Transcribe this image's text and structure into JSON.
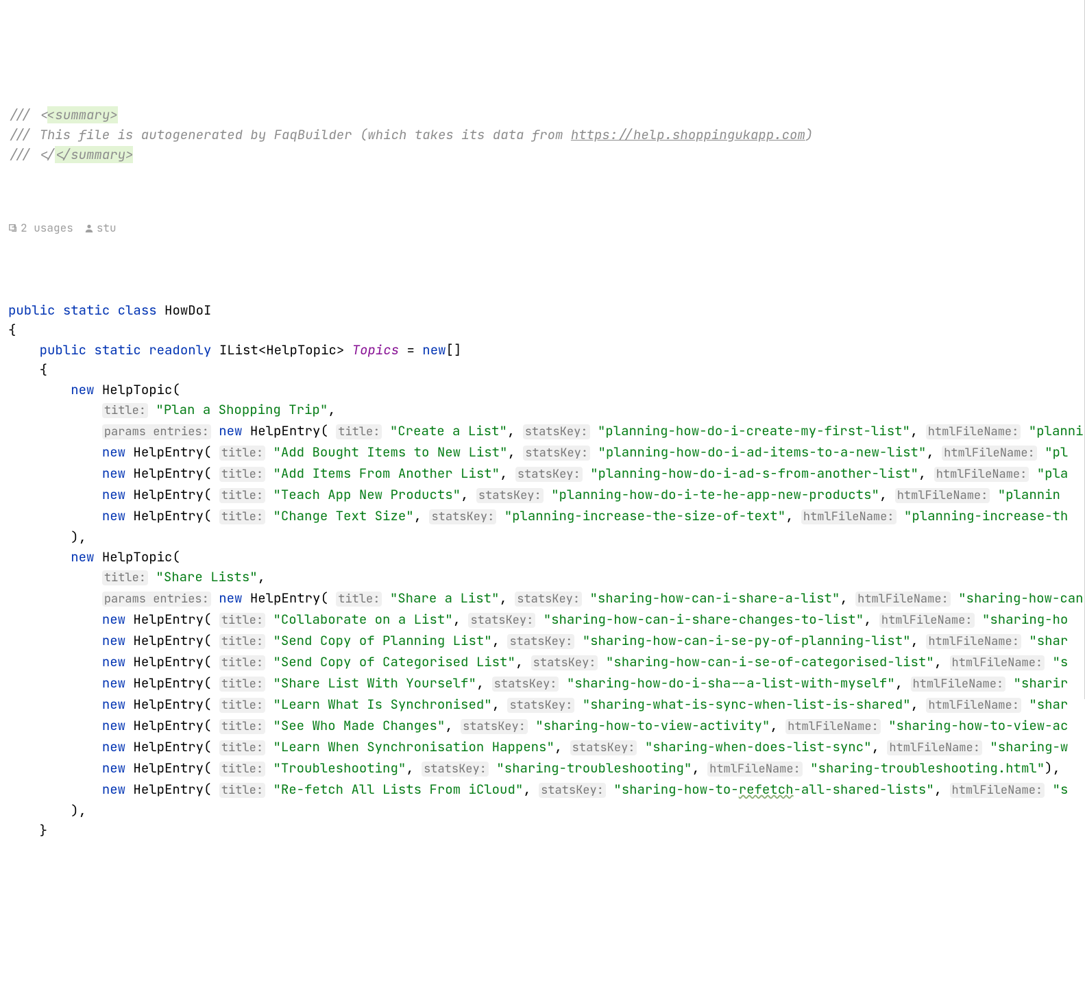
{
  "comments": {
    "summaryOpen": "<summary>",
    "summaryClose": "</summary>",
    "prefix": "/// ",
    "bodyPrefix": "This file is autogenerated by FaqBuilder (which takes its data from ",
    "link": "https://help.shoppingukapp.com",
    "bodySuffix": ")"
  },
  "codeLens": {
    "usages": "2 usages",
    "author": "stu"
  },
  "keywords": {
    "public": "public",
    "static": "static",
    "class": "class",
    "readonly": "readonly",
    "new": "new"
  },
  "classDecl": {
    "name": "HowDoI"
  },
  "field": {
    "type": "IList",
    "generic": "HelpTopic",
    "name": "Topics",
    "equals": " = ",
    "arrSuffix": "[]"
  },
  "hints": {
    "title": "title:",
    "paramsEntries": "params entries:",
    "statsKey": "statsKey:",
    "htmlFileName": "htmlFileName:"
  },
  "types": {
    "helpTopic": "HelpTopic",
    "helpEntry": "HelpEntry"
  },
  "topics": [
    {
      "title": "\"Plan a Shopping Trip\"",
      "entries": [
        {
          "title": "\"Create a List\"",
          "statsKey": "\"planning-how-do-i-create-my-first-list\"",
          "htmlFileName": "\"plannin",
          "paramsPrefix": true
        },
        {
          "title": "\"Add Bought Items to New List\"",
          "statsKey": "\"planning-how-do-i-ad-items-to-a-new-list\"",
          "htmlFileName": "\"pl"
        },
        {
          "title": "\"Add Items From Another List\"",
          "statsKey": "\"planning-how-do-i-ad-s-from-another-list\"",
          "htmlFileName": "\"pla"
        },
        {
          "title": "\"Teach App New Products\"",
          "statsKey": "\"planning-how-do-i-te-he-app-new-products\"",
          "htmlFileName": "\"plannin"
        },
        {
          "title": "\"Change Text Size\"",
          "statsKey": "\"planning-increase-the-size-of-text\"",
          "htmlFileName": "\"planning-increase-th"
        }
      ]
    },
    {
      "title": "\"Share Lists\"",
      "entries": [
        {
          "title": "\"Share a List\"",
          "statsKey": "\"sharing-how-can-i-share-a-list\"",
          "htmlFileName": "\"sharing-how-can-",
          "paramsPrefix": true
        },
        {
          "title": "\"Collaborate on a List\"",
          "statsKey": "\"sharing-how-can-i-share-changes-to-list\"",
          "htmlFileName": "\"sharing-ho"
        },
        {
          "title": "\"Send Copy of Planning List\"",
          "statsKey": "\"sharing-how-can-i-se-py-of-planning-list\"",
          "htmlFileName": "\"shar"
        },
        {
          "title": "\"Send Copy of Categorised List\"",
          "statsKey": "\"sharing-how-can-i-se-of-categorised-list\"",
          "htmlFileName": "\"s"
        },
        {
          "title": "\"Share List With Yourself\"",
          "statsKey": "\"sharing-how-do-i-sha--a-list-with-myself\"",
          "htmlFileName": "\"sharir"
        },
        {
          "title": "\"Learn What Is Synchronised\"",
          "statsKey": "\"sharing-what-is-sync-when-list-is-shared\"",
          "htmlFileName": "\"shar"
        },
        {
          "title": "\"See Who Made Changes\"",
          "statsKey": "\"sharing-how-to-view-activity\"",
          "htmlFileName": "\"sharing-how-to-view-ac"
        },
        {
          "title": "\"Learn When Synchronisation Happens\"",
          "statsKey": "\"sharing-when-does-list-sync\"",
          "htmlFileName": "\"sharing-w"
        },
        {
          "title": "\"Troubleshooting\"",
          "statsKey": "\"sharing-troubleshooting\"",
          "htmlFileName": "\"sharing-troubleshooting.html\"",
          "closed": true
        },
        {
          "title": "\"Re-fetch All Lists From iCloud\"",
          "statsKey": "\"sharing-how-to-refetch-all-shared-lists\"",
          "htmlFileName": "\"s",
          "wavy": "refetch"
        }
      ]
    }
  ]
}
